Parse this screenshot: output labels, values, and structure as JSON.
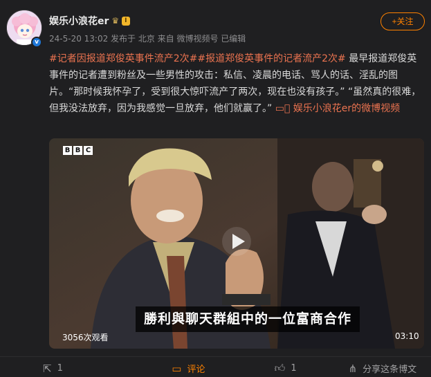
{
  "user": {
    "name": "娱乐小浪花er",
    "level": "I",
    "verified_mark": "v",
    "meta": "24-5-20 13:02  发布于 北京  来自 微博视频号  已编辑",
    "follow_label": "+关注"
  },
  "post": {
    "tag1": "#记者因报道郑俊英事件流产2次#",
    "tag2": "#报道郑俊英事件的记者流产2次#",
    "body": " 最早报道郑俊英事件的记者遭到粉丝及一些男性的攻击：私信、凌晨的电话、骂人的话、淫乱的图片。“那时候我怀孕了，受到很大惊吓流产了两次，现在也没有孩子。” “虽然真的很难，但我没法放弃，因为我感觉一旦放弃，他们就赢了。” ",
    "video_link": "娱乐小浪花er的微博视频"
  },
  "video": {
    "logo": [
      "B",
      "B",
      "C"
    ],
    "subtitle": "勝利與聊天群組中的一位富商合作",
    "views": "3056次观看",
    "duration": "03:10"
  },
  "actions": {
    "share_count": "1",
    "comment_label": "评论",
    "like_count": "1",
    "share_desc": "分享这条博文"
  },
  "icons": {
    "share": "repost-icon",
    "comment": "comment-icon",
    "like": "thumbs-up-icon",
    "sharelink": "share-icon",
    "play": "play-icon",
    "crown": "crown-icon",
    "video_link": "video-icon"
  },
  "colors": {
    "background": "#1f1f21",
    "accent": "#ff8200",
    "tag": "#eb7350",
    "verified": "#1f78d9"
  }
}
